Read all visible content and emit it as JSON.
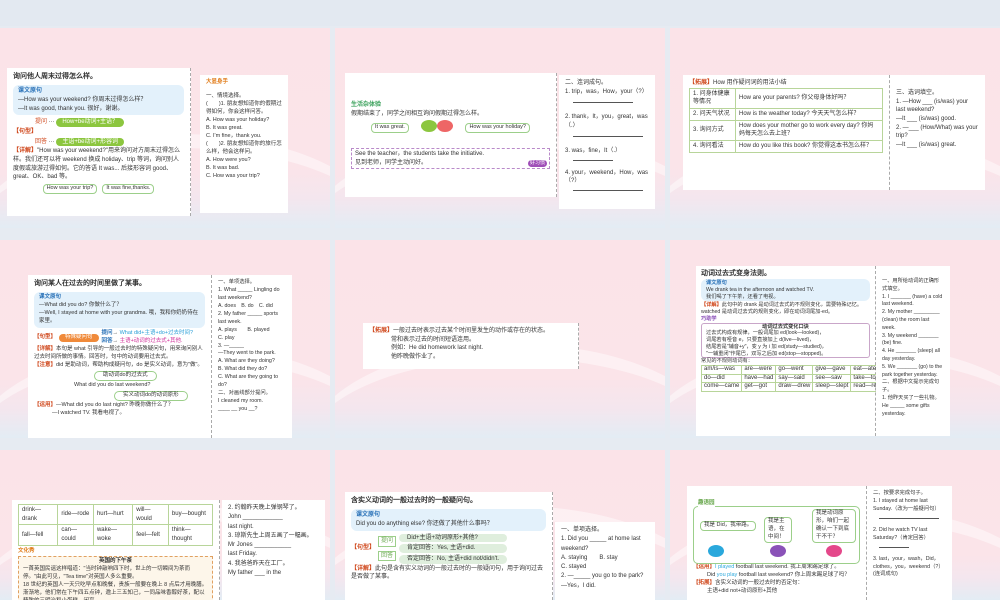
{
  "s1": {
    "title": "询问他人周末过得怎么样。",
    "box_label": "课文原句",
    "q": "—How was your weekend? 你周末过得怎么样？",
    "a": "—It was good, thank you. 很好，谢谢。",
    "pattern_label": "【句型】",
    "ask": "提问",
    "ask_p": "How+be动词+主语？",
    "ans": "回答",
    "ans_p": "主语+be动词+形容词",
    "detail_label": "【详解】",
    "detail": "\"How was your weekend?\"用来询问对方周末过得怎么样。我们还可以将 weekend 换成 holiday、trip 等词，询问别人度假或旅游过得如何。它的答语 It was... 后接形容词 good、great、OK、bad 等。",
    "bubble1": "How was your trip?",
    "bubble2": "It was fine,thanks.",
    "ex_title": "大显身手",
    "ex_head": "一、情境选择。",
    "ex": [
      "(　　)1. 朋友想知道你的假期过得如何，你会这样问答。",
      "A. How was your holiday?",
      "B. It was great.",
      "C. I'm fine，thank you.",
      "(　　)2. 朋友想知道你的旅行怎么样，他会这样问。",
      "A. How were you?",
      "B. It was bad.",
      "C. How was your trip?"
    ]
  },
  "s2": {
    "title": "生活杂体验",
    "text": "假期结束了，同学之间相互询问假期过得怎么样。",
    "bubble1": "It was great.",
    "bubble2": "How was your holiday?",
    "tip_en": "See the teacher，the students take the initiative.",
    "tip_cn": "见到老师，同学主动问好。",
    "badge": "好习惯",
    "ex_head": "二、连词成句。",
    "ex": [
      "1. trip，was，How，your（?）",
      "2. thank，It，you，great，was（.）",
      "3. was，fine，It（.）",
      "4. your，weekend，How，was（?）"
    ]
  },
  "s3": {
    "title_label": "【拓展】",
    "title": "How 用作疑问词的用法小结",
    "rows": [
      {
        "k": "1. 问身体健康等情况",
        "v": "How are your parents? 你父母身体好吗？"
      },
      {
        "k": "2. 问天气状况",
        "v": "How is the weather today? 今天天气怎么样？"
      },
      {
        "k": "3. 询问方式",
        "v": "How does your mother go to work every day? 你妈妈每天怎么去上班？"
      },
      {
        "k": "4. 询问看法",
        "v": "How do you like this book? 你觉得这本书怎么样？"
      }
    ],
    "ex_head": "三、选词填空。",
    "ex": [
      "1. —How ___ (is/was) your last weekend?",
      "—It ___ (is/was) good.",
      "2. —___ (How/What) was your trip?",
      "—It ___ (is/was) great."
    ]
  },
  "s4": {
    "title": "询问某人在过去的时间里做了某事。",
    "box_label": "课文原句",
    "q": "—What did you do? 你做什么了？",
    "a": "—Well, I stayed at home with your grandma. 哦，我和你奶奶待在家里。",
    "pattern_label": "【句型】",
    "center": "特殊疑问句",
    "ask": "提问",
    "ask_p": "What did+主语+do+过去时间?",
    "ans": "回答",
    "ans_p": "主语+动词的过去式+其他.",
    "detail_label": "【详解】",
    "detail": "本句是 what 引导的一般过去时的特殊疑问句，用来询问别人过去时间所做的事情。回答时，句中的动词要用过去式。",
    "note_label": "【注意】",
    "note": "did 是助动词，帮助构成疑问句，do 是实义动词，意为\"做\"。",
    "diag1": "助动词do的过去式",
    "diag_q": "What did you do last weekend?",
    "diag2": "实义动词do的动词原形",
    "use_label": "【运用】",
    "use_q": "—What did you do last night? 昨晚你做什么了？",
    "use_a": "—I watched TV. 我看电视了。",
    "ex": [
      "一、单项选择。",
      "1. What _____ Lingling do last weekend?",
      "A. does　B. do　C. did",
      "2. My father _____ sports last week.",
      "A. plays　　B. played",
      "C. play",
      "3. —_____",
      "—They went to the park.",
      "A. What are they doing?",
      "B. What did they do?",
      "C. What are they going to do?",
      "二、对画线部分提问。",
      "I cleaned my room.",
      "____ __ you __?"
    ]
  },
  "s5": {
    "label": "【拓展】",
    "l1": "一般过去时表示过去某个时间里发生的动作或存在的状态。",
    "l2": "常和表示过去的时间短语连用。",
    "l3": "例如：He did homework last night.",
    "l4": "他昨晚做作业了。"
  },
  "s6": {
    "title": "动词过去式变身法则。",
    "box_label": "课文原句",
    "en": "We drank tea in the afternoon and watched TV.",
    "cn": "我们喝了下午茶，还看了电视。",
    "detail_label": "【详解】",
    "detail": "此句中的 drank 是动词过去式的不规则变化，需要特殊记忆。watched 是动词过去式的规则变化，即在动词词尾加-ed。",
    "tip_label": "巧助学",
    "rule_title": "动词过去式变化口诀",
    "rules": [
      "过去式构成有规律，一般词尾加 ed(look—looked)，",
      "词尾若有哑音 e，只要直接加上 d(live—lived)，",
      "结尾若是\"辅音+y\"，变 y 为 i 加 ed(study—studied)，",
      "\"一辅重闭\"作尾巴，双写之后加 ed(stop—stopped)。"
    ],
    "irr_title": "常见的不规则动词有：",
    "irr": [
      [
        "am/is—was",
        "are—were",
        "go—went",
        "give—gave",
        "eat—ate"
      ],
      [
        "do—did",
        "have—had",
        "say—said",
        "see—saw",
        "take—took"
      ],
      [
        "come—came",
        "get—got",
        "draw—drew",
        "sleep—slept",
        "read—read"
      ]
    ],
    "ex": [
      "一、用所给动词的正确形式填空。",
      "1. I _______ (have) a cold last weekend.",
      "2. My mother _________ (clean) the room last week.",
      "3. My weekend _______ (be) fine.",
      "4. He _______ (sleep) all day yesterday.",
      "5. We _______ (go) to the park together yesterday.",
      "二、根据中文提示完成句子。",
      "1. 他昨天买了一些礼物。",
      "He _____ some gifts yesterday."
    ]
  },
  "s7": {
    "irr": [
      [
        "drink—drank",
        "ride—rode",
        "hurt—hurt",
        "will—would",
        "buy—bought"
      ],
      [
        "fall—fell",
        "can—could",
        "wake—woke",
        "feel—felt",
        "think—thought"
      ]
    ],
    "culture_label": "文化秀",
    "culture_title": "英国的下午茶",
    "p1": "一首英国民谣这样唱道：\"当时钟敲响四下时，世上的一切瞬间为茶而停。\"由此可见，\"Tea time\"对英国人多么重要。",
    "p2": "18 世纪的英国人一天只吃早点和晚餐，贵族一般要在晚上 8 点后才用晚膳。渐渐地，他们常在下午四五点钟，邀上三五知己，一同品味香醇好茶，配以精致的三明治和小蛋糕，闲享",
    "ex": [
      "2. 约翰昨天晚上弹钢琴了。",
      "John ____________",
      "last night.",
      "3. 琼斯先生上周五画了一幅画。",
      "Mr Jones ___________",
      "last Friday.",
      "4. 我爸爸昨天在工厂。",
      "My father ___ in the"
    ]
  },
  "s8": {
    "title": "含实义动词的一般过去时的一般疑问句。",
    "box_label": "课文原句",
    "en": "Did you do anything else? 你还做了其他什么事吗？",
    "pattern_label": "【句型】",
    "ask": "提问",
    "ans": "回答",
    "p1": "Did+主语+动词原形+其他?",
    "p2": "肯定回答：Yes, 主语+did.",
    "p3": "否定回答：No, 主语+did not/didn't.",
    "detail_label": "【详解】",
    "detail": "此句是含有实义动词的一般过去时的一般疑问句，用于询问过去是否做了某事。",
    "ex": [
      "一、单项选择。",
      "1. Did you _____ at home last weekend?",
      "A. staying　　B. stay",
      "C. stayed",
      "2. —_____ you go to the park?",
      "—Yes，I did."
    ]
  },
  "s9": {
    "tip_label": "趣语园",
    "b1": "我是 Did，我带路。",
    "b2": "我是主语，在中间！",
    "b3": "我是动词原形，咱们一起确认一下到底干不干？",
    "use_label": "【运用】",
    "use1_hl": "I played",
    "use1": " football last weekend. 我上周末踢足球了。",
    "use2_a": "Did ",
    "use2_hl": "you play",
    "use2": " football last weekend? 你上周末踢足球了吗？",
    "ext_label": "【拓展】",
    "ext": "含实义动词的一般过去时的否定句：",
    "ext2": "主语+did not+动词原形+其他",
    "ex": [
      "二、按要求完成句子。",
      "1. I stayed at home last Sunday.（改为一般疑问句）",
      "2. Did he watch TV last Saturday?（肯定回答）",
      "3. last，your，wash，Did，clothes，you，weekend（?）(连词成句)"
    ]
  },
  "colors": {
    "accent_red": "#d04a1f",
    "accent_green": "#8cc63f",
    "accent_blue": "#2a72b8"
  }
}
